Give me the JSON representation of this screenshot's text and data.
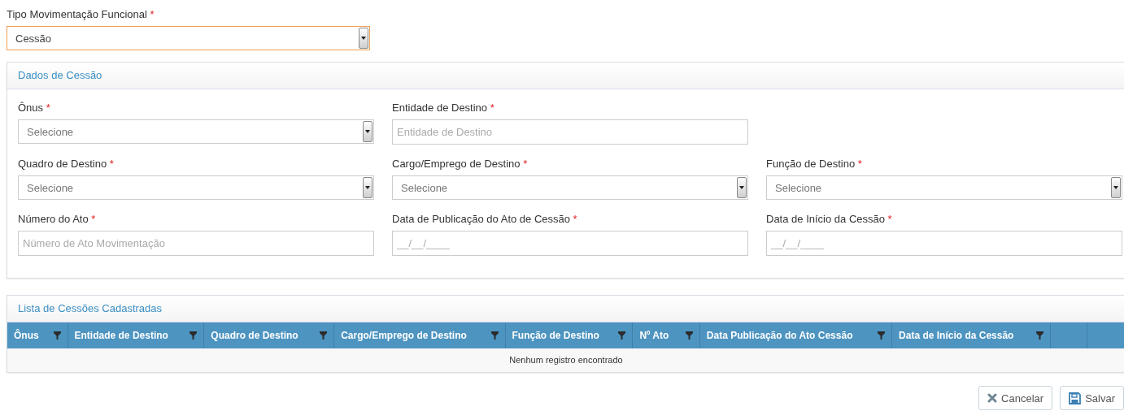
{
  "tipo": {
    "label": "Tipo Movimentação Funcional",
    "required_mark": "*",
    "value": "Cessão",
    "focused": true
  },
  "dados": {
    "title": "Dados de Cessão",
    "fields": [
      {
        "kind": "select",
        "label": "Ônus",
        "required_mark": "*",
        "placeholder": "Selecione"
      },
      {
        "kind": "text",
        "label": "Entidade de Destino",
        "required_mark": "*",
        "placeholder": "Entidade de Destino"
      },
      {
        "kind": "blank"
      },
      {
        "kind": "select",
        "label": "Quadro de Destino",
        "required_mark": "*",
        "placeholder": "Selecione"
      },
      {
        "kind": "select",
        "label": "Cargo/Emprego de Destino",
        "required_mark": "*",
        "placeholder": "Selecione"
      },
      {
        "kind": "select",
        "label": "Função de Destino",
        "required_mark": "*",
        "placeholder": "Selecione"
      },
      {
        "kind": "text",
        "label": "Número do Ato",
        "required_mark": "*",
        "placeholder": "Número de Ato Movimentação"
      },
      {
        "kind": "date",
        "label": "Data de Publicação do Ato de Cessão",
        "required_mark": "*",
        "placeholder": "__/__/____"
      },
      {
        "kind": "date",
        "label": "Data de Início da Cessão",
        "required_mark": "*",
        "placeholder": "__/__/____"
      }
    ]
  },
  "lista": {
    "title": "Lista de Cessões Cadastradas",
    "columns": [
      {
        "label": "Ônus",
        "filterable": true
      },
      {
        "label": "Entidade de Destino",
        "filterable": true
      },
      {
        "label": "Quadro de Destino",
        "filterable": true
      },
      {
        "label": "Cargo/Emprego de Destino",
        "filterable": true
      },
      {
        "label": "Função de Destino",
        "filterable": true
      },
      {
        "label": "Nº Ato",
        "filterable": true
      },
      {
        "label": "Data Publicação do Ato Cessão",
        "filterable": true
      },
      {
        "label": "Data de Início da Cessão",
        "filterable": true
      }
    ],
    "empty_message": "Nenhum registro encontrado"
  },
  "buttons": [
    {
      "kind": "cancel",
      "label": "Cancelar"
    },
    {
      "kind": "save",
      "label": "Salvar"
    }
  ]
}
